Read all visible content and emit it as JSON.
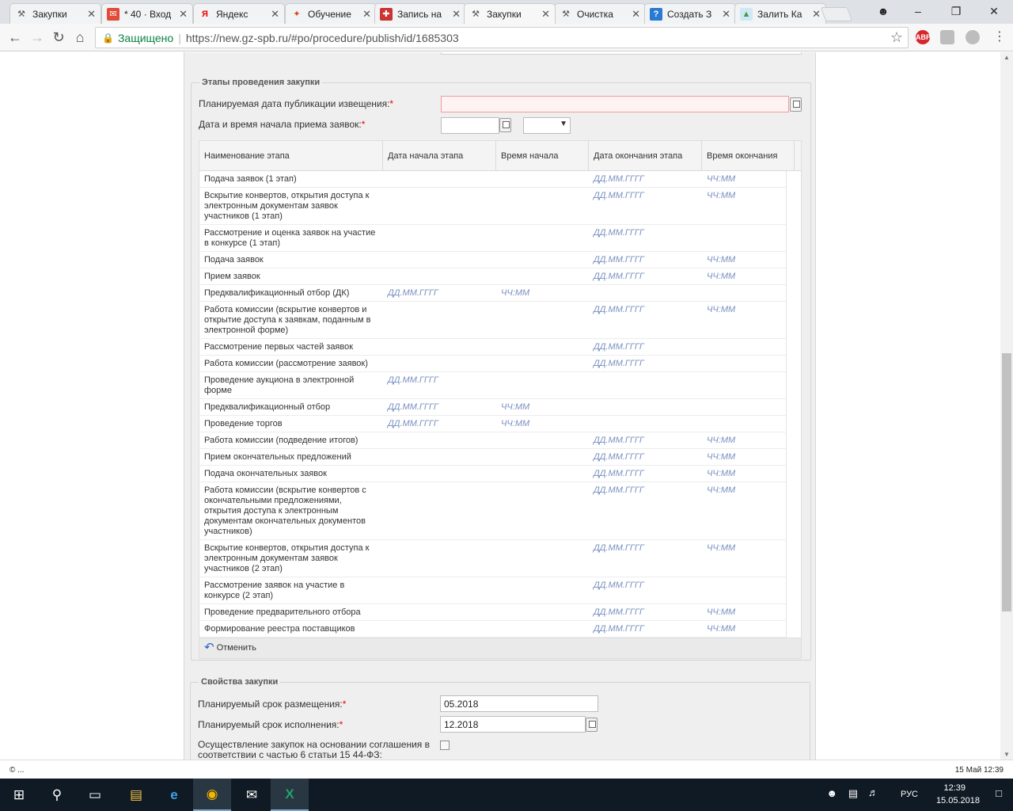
{
  "tabs": [
    {
      "title": "Закупки",
      "icon": "hammer-icon"
    },
    {
      "title": "* 40 · Вход",
      "icon": "mail-icon"
    },
    {
      "title": "Яндекс",
      "icon": "yandex-icon"
    },
    {
      "title": "Обучение",
      "icon": "brand-icon"
    },
    {
      "title": "Запись на",
      "icon": "shield-icon"
    },
    {
      "title": "Закупки",
      "icon": "hammer-icon"
    },
    {
      "title": "Очистка",
      "icon": "hammer-icon"
    },
    {
      "title": "Создать З",
      "icon": "help-icon"
    },
    {
      "title": "Залить Ка",
      "icon": "image-icon"
    }
  ],
  "browser": {
    "secure_label": "Защищено",
    "url": "https://new.gz-spb.ru/#po/procedure/publish/id/1685303",
    "abp_label": "ABP"
  },
  "stages": {
    "legend": "Этапы проведения закупки",
    "pub_date_label": "Планируемая дата публикации извещения:",
    "start_label": "Дата и время начала приема заявок:",
    "required_mark": "*",
    "headers": [
      "Наименование этапа",
      "Дата начала этапа",
      "Время начала",
      "Дата окончания этапа",
      "Время окончания"
    ],
    "rows": [
      {
        "name": "Подача заявок (1 этап)",
        "ds": "",
        "ts": "",
        "de": "ДД.ММ.ГГГГ",
        "te": "ЧЧ:ММ"
      },
      {
        "name": "Вскрытие конвертов, открытия доступа к электронным документам заявок участников (1 этап)",
        "ds": "",
        "ts": "",
        "de": "ДД.ММ.ГГГГ",
        "te": "ЧЧ:ММ"
      },
      {
        "name": "Рассмотрение и оценка заявок на участие в конкурсе (1 этап)",
        "ds": "",
        "ts": "",
        "de": "ДД.ММ.ГГГГ",
        "te": ""
      },
      {
        "name": "Подача заявок",
        "ds": "",
        "ts": "",
        "de": "ДД.ММ.ГГГГ",
        "te": "ЧЧ:ММ"
      },
      {
        "name": "Прием заявок",
        "ds": "",
        "ts": "",
        "de": "ДД.ММ.ГГГГ",
        "te": "ЧЧ:ММ"
      },
      {
        "name": "Предквалификационный отбор (ДК)",
        "ds": "ДД.ММ.ГГГГ",
        "ts": "ЧЧ:ММ",
        "de": "",
        "te": ""
      },
      {
        "name": "Работа комиссии (вскрытие конвертов и открытие доступа к заявкам, поданным в электронной форме)",
        "ds": "",
        "ts": "",
        "de": "ДД.ММ.ГГГГ",
        "te": "ЧЧ:ММ"
      },
      {
        "name": "Рассмотрение первых частей заявок",
        "ds": "",
        "ts": "",
        "de": "ДД.ММ.ГГГГ",
        "te": ""
      },
      {
        "name": "Работа комиссии (рассмотрение заявок)",
        "ds": "",
        "ts": "",
        "de": "ДД.ММ.ГГГГ",
        "te": ""
      },
      {
        "name": "Проведение аукциона в электронной форме",
        "ds": "ДД.ММ.ГГГГ",
        "ts": "",
        "de": "",
        "te": ""
      },
      {
        "name": "Предквалификационный отбор",
        "ds": "ДД.ММ.ГГГГ",
        "ts": "ЧЧ:ММ",
        "de": "",
        "te": ""
      },
      {
        "name": "Проведение торгов",
        "ds": "ДД.ММ.ГГГГ",
        "ts": "ЧЧ:ММ",
        "de": "",
        "te": ""
      },
      {
        "name": "Работа комиссии (подведение итогов)",
        "ds": "",
        "ts": "",
        "de": "ДД.ММ.ГГГГ",
        "te": "ЧЧ:ММ"
      },
      {
        "name": "Прием окончательных предложений",
        "ds": "",
        "ts": "",
        "de": "ДД.ММ.ГГГГ",
        "te": "ЧЧ:ММ"
      },
      {
        "name": "Подача окончательных заявок",
        "ds": "",
        "ts": "",
        "de": "ДД.ММ.ГГГГ",
        "te": "ЧЧ:ММ"
      },
      {
        "name": "Работа комиссии (вскрытие конвертов с окончательными предложениями, открытия доступа к электронным документам окончательных документов участников)",
        "ds": "",
        "ts": "",
        "de": "ДД.ММ.ГГГГ",
        "te": "ЧЧ:ММ"
      },
      {
        "name": "Вскрытие конвертов, открытия доступа к электронным документам заявок участников (2 этап)",
        "ds": "",
        "ts": "",
        "de": "ДД.ММ.ГГГГ",
        "te": "ЧЧ:ММ"
      },
      {
        "name": "Рассмотрение заявок на участие в конкурсе (2 этап)",
        "ds": "",
        "ts": "",
        "de": "ДД.ММ.ГГГГ",
        "te": ""
      },
      {
        "name": "Проведение предварительного отбора",
        "ds": "",
        "ts": "",
        "de": "ДД.ММ.ГГГГ",
        "te": "ЧЧ:ММ"
      },
      {
        "name": "Формирование реестра поставщиков",
        "ds": "",
        "ts": "",
        "de": "ДД.ММ.ГГГГ",
        "te": "ЧЧ:ММ"
      }
    ],
    "undo_label": "Отменить"
  },
  "props": {
    "legend": "Свойства закупки",
    "placement_label": "Планируемый срок размещения:",
    "placement_value": "05.2018",
    "execution_label": "Планируемый срок исполнения:",
    "execution_value": "12.2018",
    "agreement_label": "Осуществление закупок на основании соглашения в соответствии с частью 6 статьи 15 44-ФЗ:"
  },
  "statusbar": {
    "left": "© ...",
    "right": "15 Май 12:39"
  },
  "taskbar": {
    "lang": "РУС",
    "time": "12:39",
    "date": "15.05.2018"
  },
  "colors": {
    "placeholder": "#7a90c0",
    "required": "#ee0000",
    "error_field": "#fff2f2"
  }
}
